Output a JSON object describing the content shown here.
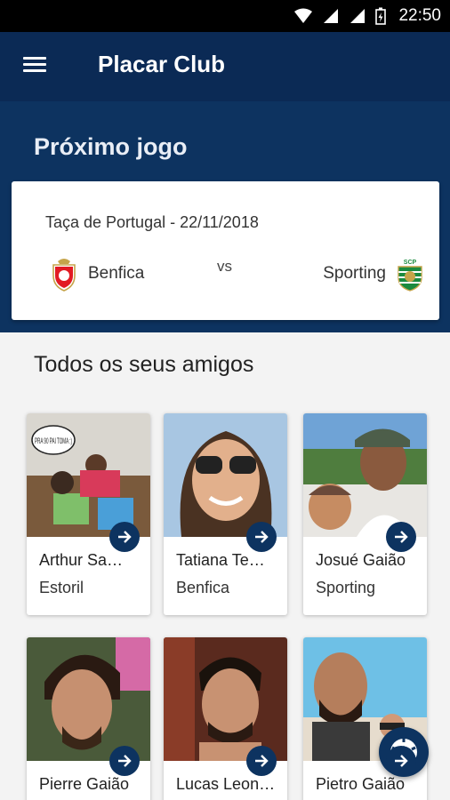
{
  "status_bar": {
    "time": "22:50"
  },
  "app_bar": {
    "title": "Placar Club"
  },
  "next_game": {
    "heading": "Próximo jogo",
    "competition": "Taça de Portugal - 22/11/2018",
    "home_team": "Benfica",
    "vs_label": "vs",
    "away_team": "Sporting",
    "away_crest_text": "SCP"
  },
  "friends": {
    "heading": "Todos os seus amigos",
    "items": [
      {
        "name": "Arthur Sa…",
        "club": "Estoril",
        "photo_caption": "PRA 90 PAI TOMA :)"
      },
      {
        "name": "Tatiana Te…",
        "club": "Benfica"
      },
      {
        "name": "Josué Gaião",
        "club": "Sporting"
      },
      {
        "name": "Pierre Gaião",
        "club": ""
      },
      {
        "name": "Lucas Leon…",
        "club": ""
      },
      {
        "name": "Pietro Gaião",
        "club": ""
      }
    ]
  },
  "colors": {
    "app_bar": "#0b2a55",
    "hero": "#0d3360",
    "accent": "#0d3360"
  }
}
